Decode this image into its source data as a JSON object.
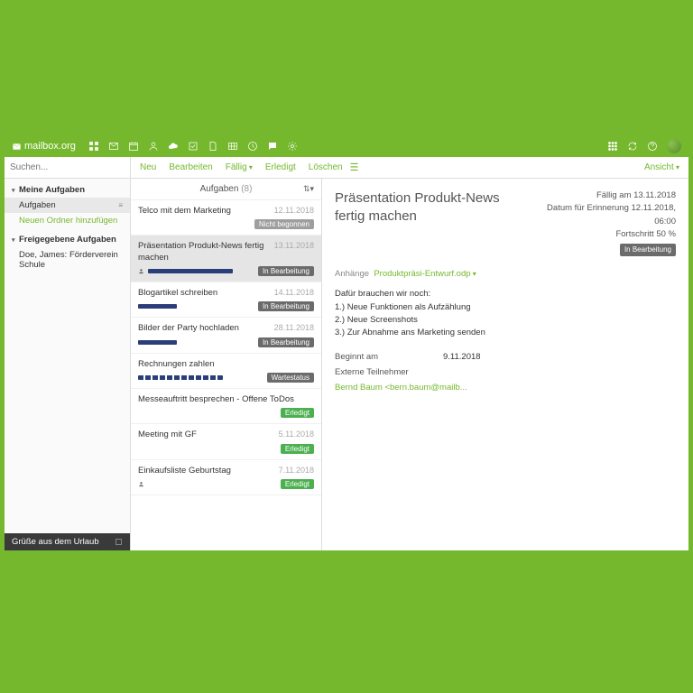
{
  "brand": "mailbox.org",
  "search": {
    "placeholder": "Suchen..."
  },
  "toolbar": {
    "neu": "Neu",
    "bearbeiten": "Bearbeiten",
    "faellig": "Fällig",
    "erledigt": "Erledigt",
    "loeschen": "Löschen",
    "ansicht": "Ansicht"
  },
  "sidebar": {
    "sec1": "Meine Aufgaben",
    "item1": "Aufgaben",
    "new_folder": "Neuen Ordner hinzufügen",
    "sec2": "Freigegebene Aufgaben",
    "shared1": "Doe, James: Förderverein Schule",
    "footer": "Grüße aus dem Urlaub"
  },
  "list": {
    "header": "Aufgaben",
    "count": "(8)",
    "tasks": [
      {
        "title": "Telco mit dem Marketing",
        "date": "12.11.2018",
        "badge": "Nicht begonnen",
        "badgeCls": "b-gray",
        "prog": "",
        "user": false
      },
      {
        "title": "Präsentation Produkt-News fertig machen",
        "date": "13.11.2018",
        "badge": "In Bearbeitung",
        "badgeCls": "b-dg",
        "prog": "half",
        "user": true,
        "sel": true
      },
      {
        "title": "Blogartikel schreiben",
        "date": "14.11.2018",
        "badge": "In Bearbeitung",
        "badgeCls": "b-dg",
        "prog": "q",
        "user": false
      },
      {
        "title": "Bilder der Party hochladen",
        "date": "28.11.2018",
        "badge": "In Bearbeitung",
        "badgeCls": "b-dg",
        "prog": "q",
        "user": false
      },
      {
        "title": "Rechnungen zahlen",
        "date": "",
        "badge": "Wartestatus",
        "badgeCls": "b-dg",
        "prog": "half",
        "user": false,
        "dashed": true
      },
      {
        "title": "Messeauftritt besprechen - Offene ToDos",
        "date": "",
        "badge": "Erledigt",
        "badgeCls": "b-green",
        "prog": "",
        "user": false
      },
      {
        "title": "Meeting mit GF",
        "date": "5.11.2018",
        "badge": "Erledigt",
        "badgeCls": "b-green",
        "prog": "",
        "user": false
      },
      {
        "title": "Einkaufsliste Geburtstag",
        "date": "7.11.2018",
        "badge": "Erledigt",
        "badgeCls": "b-green",
        "prog": "",
        "user": true
      }
    ]
  },
  "detail": {
    "title": "Präsentation Produkt-News fertig machen",
    "due": "Fällig am 13.11.2018",
    "reminder": "Datum für Erinnerung 12.11.2018, 06:00",
    "progress": "Fortschritt 50 %",
    "status": "In Bearbeitung",
    "att_label": "Anhänge",
    "att_file": "Produktpräsi-Entwurf.odp",
    "body_intro": "Dafür brauchen wir noch:",
    "body_1": "1.) Neue Funktionen als Aufzählung",
    "body_2": "2.) Neue Screenshots",
    "body_3": "3.) Zur Abnahme ans Marketing senden",
    "start_lbl": "Beginnt am",
    "start_val": "9.11.2018",
    "ext_lbl": "Externe Teilnehmer",
    "participant": "Bernd Baum <bern.baum@mailb..."
  }
}
